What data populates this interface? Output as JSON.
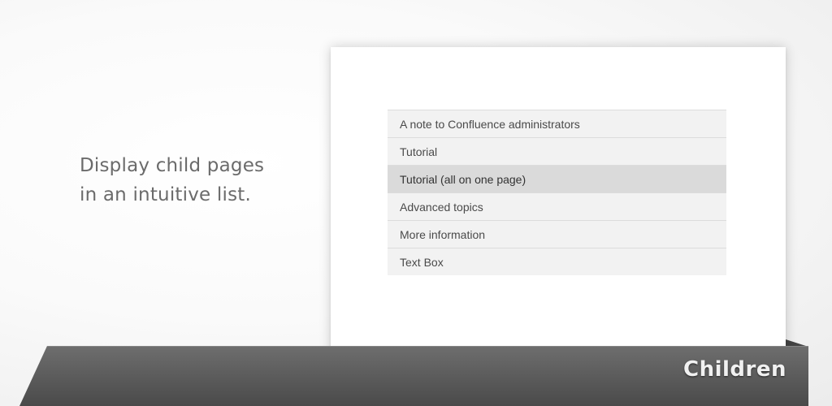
{
  "tagline": {
    "line1": "Display child pages",
    "line2": "in an intuitive list."
  },
  "child_pages": {
    "items": [
      {
        "label": "A note to Confluence administrators",
        "active": false
      },
      {
        "label": "Tutorial",
        "active": false
      },
      {
        "label": "Tutorial (all on one page)",
        "active": true
      },
      {
        "label": "Advanced topics",
        "active": false
      },
      {
        "label": "More information",
        "active": false
      },
      {
        "label": "Text Box",
        "active": false
      }
    ]
  },
  "banner": {
    "title": "Children"
  },
  "colors": {
    "row_background": "#f2f2f2",
    "row_active_background": "#dadada",
    "banner_dark": "#4a4a4a",
    "banner_light": "#6e6e6e"
  }
}
